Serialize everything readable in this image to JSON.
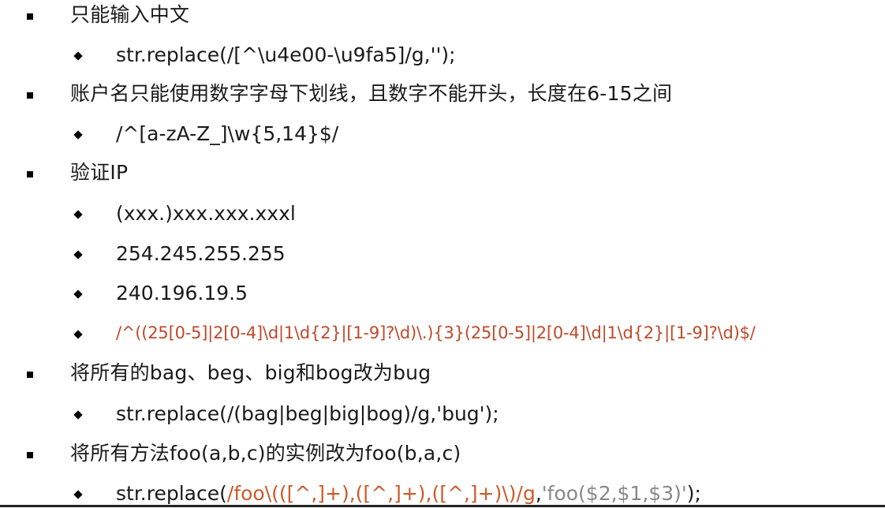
{
  "items": [
    {
      "level": 1,
      "text": "只能输入中文"
    },
    {
      "level": 2,
      "text": "str.replace(/[^\\u4e00-\\u9fa5]/g,'');"
    },
    {
      "level": 1,
      "text": "账户名只能使用数字字母下划线，且数字不能开头，长度在6-15之间"
    },
    {
      "level": 2,
      "text": "/^[a-zA-Z_]\\w{5,14}$/"
    },
    {
      "level": 1,
      "text": "验证IP"
    },
    {
      "level": 2,
      "text": "(xxx.)xxx.xxx.xxxl"
    },
    {
      "level": 2,
      "text": "254.245.255.255"
    },
    {
      "level": 2,
      "text": "240.196.19.5"
    },
    {
      "level": 2,
      "text": "/^((25[0-5]|2[0-4]\\d|1\\d{2}|[1-9]?\\d)\\.){3}(25[0-5]|2[0-4]\\d|1\\d{2}|[1-9]?\\d)$/"
    },
    {
      "level": 1,
      "text": "将所有的bag、beg、big和bog改为bug"
    },
    {
      "level": 2,
      "text": "str.replace(/(bag|beg|big|bog)/g,'bug');"
    },
    {
      "level": 1,
      "text": "将所有方法foo(a,b,c)的实例改为foo(b,a,c)"
    }
  ],
  "last_line": {
    "prefix": "str.replace(",
    "regex": "/foo\\(([^,]+),([^,]+),([^,]+)\\)/g",
    "comma": ",",
    "replacement": "'foo($2,$1,$3)'",
    "suffix": ");"
  },
  "colors": {
    "text": "#1a1a1a",
    "regex_red": "#c0492a",
    "regex_orange": "#cc5a2a",
    "replacement_gray": "#888888",
    "bullet": "#000000"
  }
}
